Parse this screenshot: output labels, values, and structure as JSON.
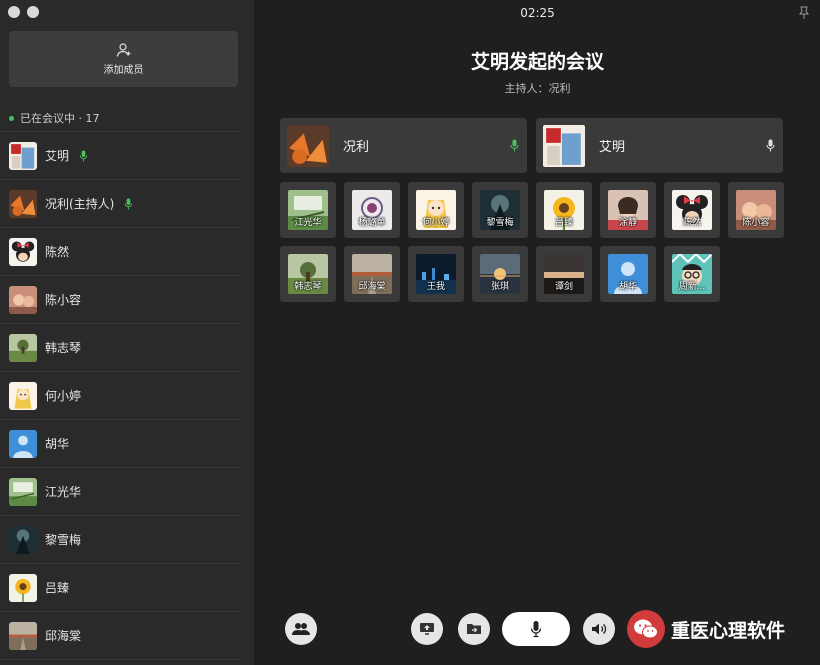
{
  "window": {
    "clock": "02:25"
  },
  "sidebar": {
    "add_member_label": "添加成员",
    "in_meeting_label": "已在会议中 · 17",
    "members": [
      {
        "name": "艾明",
        "speaking": true,
        "art": "flag"
      },
      {
        "name": "况利(主持人)",
        "speaking": true,
        "art": "orange"
      },
      {
        "name": "陈然",
        "speaking": false,
        "art": "minnie"
      },
      {
        "name": "陈小容",
        "speaking": false,
        "art": "kids"
      },
      {
        "name": "韩志琴",
        "speaking": false,
        "art": "field"
      },
      {
        "name": "何小婷",
        "speaking": false,
        "art": "cartoon"
      },
      {
        "name": "胡华",
        "speaking": false,
        "art": "default"
      },
      {
        "name": "江光华",
        "speaking": false,
        "art": "green"
      },
      {
        "name": "黎雪梅",
        "speaking": false,
        "art": "night"
      },
      {
        "name": "吕臻",
        "speaking": false,
        "art": "sunflower"
      },
      {
        "name": "邱海棠",
        "speaking": false,
        "art": "road"
      }
    ]
  },
  "meeting": {
    "title": "艾明发起的会议",
    "host_line": "主持人：况利",
    "featured": [
      {
        "name": "况利",
        "art": "orange",
        "mic_color": "#48c15b"
      },
      {
        "name": "艾明",
        "art": "flag",
        "mic_color": "#e0e0e0"
      }
    ],
    "tiles": [
      {
        "name": "江光华",
        "art": "green"
      },
      {
        "name": "杨璐单",
        "art": "sketch"
      },
      {
        "name": "何小婷",
        "art": "cartoon"
      },
      {
        "name": "黎雪梅",
        "art": "night"
      },
      {
        "name": "吕臻",
        "art": "sunflower"
      },
      {
        "name": "涂静",
        "art": "girl"
      },
      {
        "name": "陈然",
        "art": "minnie"
      },
      {
        "name": "陈小容",
        "art": "kids"
      },
      {
        "name": "韩志琴",
        "art": "field"
      },
      {
        "name": "邱海棠",
        "art": "road"
      },
      {
        "name": "王我",
        "art": "city"
      },
      {
        "name": "张琪",
        "art": "sunset"
      },
      {
        "name": "谭剑",
        "art": "dusk"
      },
      {
        "name": "胡华",
        "art": "default"
      },
      {
        "name": "周新...",
        "art": "glasses"
      }
    ]
  },
  "watermark": {
    "text": "重医心理软件"
  },
  "colors": {
    "accent_green": "#48c15b",
    "panel": "#3a3a3a",
    "background": "#1f1f1f"
  }
}
